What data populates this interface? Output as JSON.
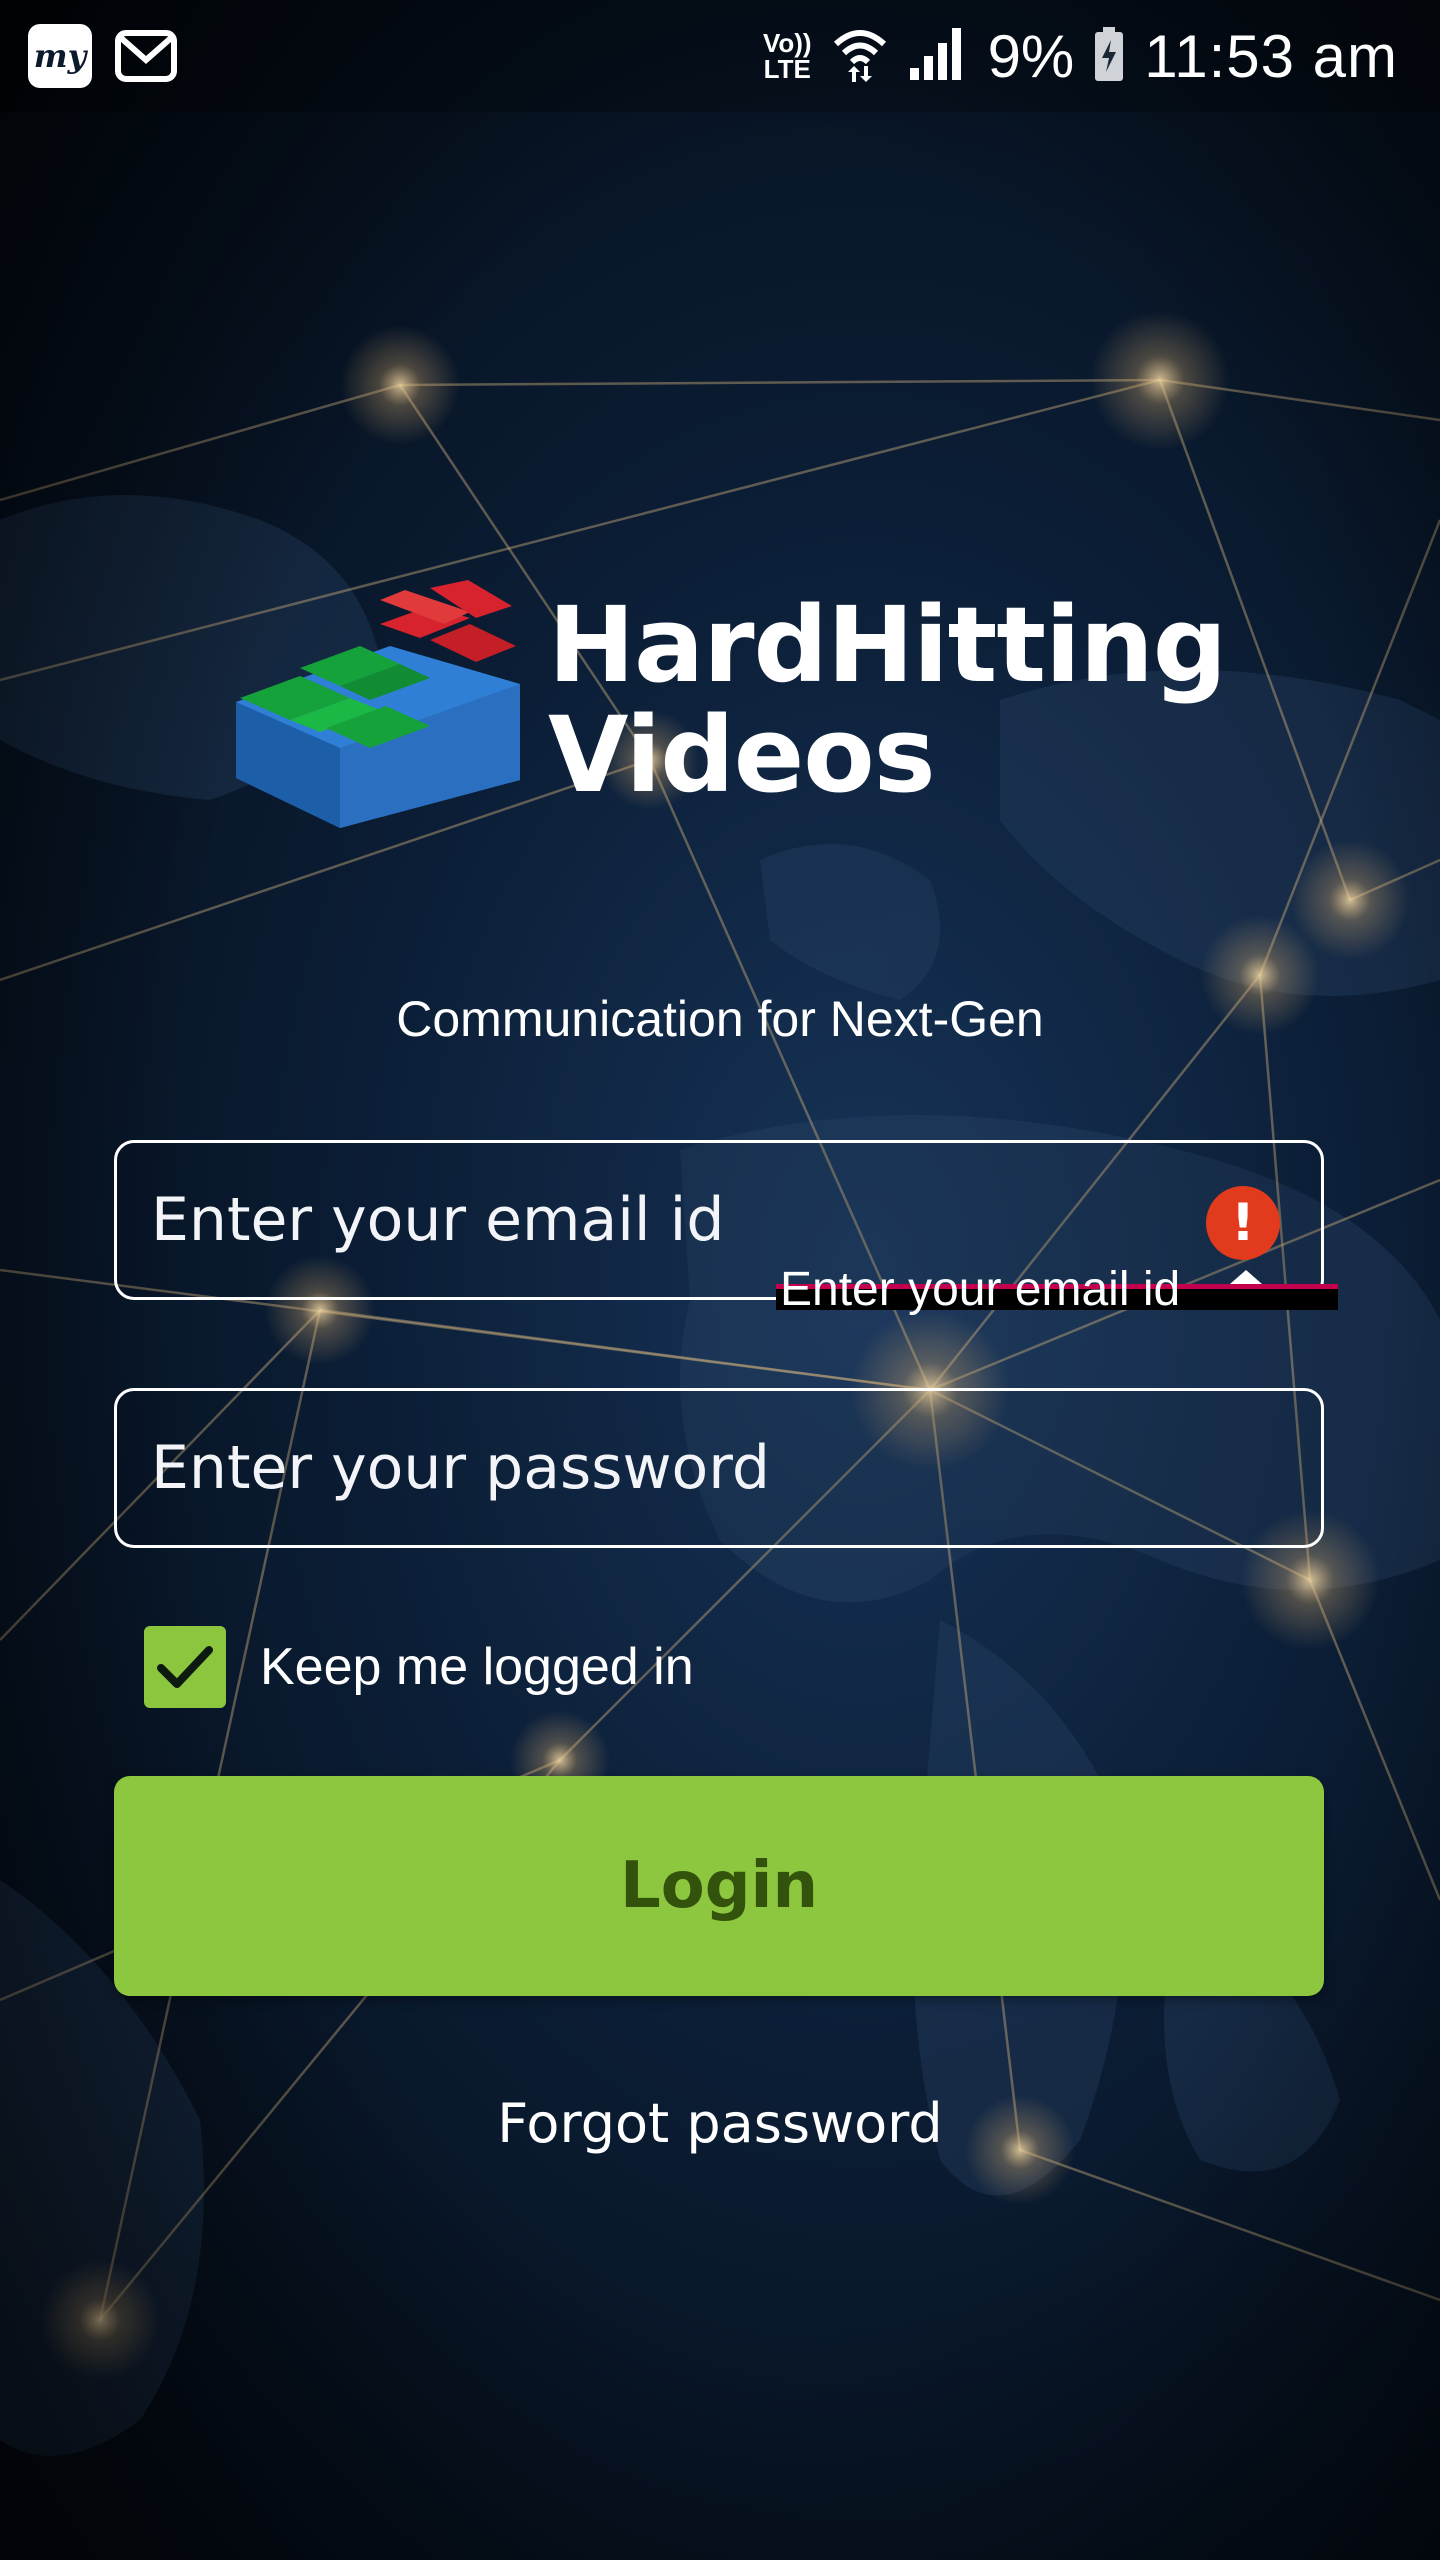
{
  "status_bar": {
    "app_icon_text": "my",
    "network_type_top": "Vo))",
    "network_type_bottom": "LTE",
    "battery_percent": "9%",
    "time": "11:53 am"
  },
  "logo": {
    "line1": "HardHitting",
    "line2": "Videos",
    "mark_colors": {
      "red": "#d6232e",
      "green": "#16a23a",
      "blue": "#2f7fd6"
    }
  },
  "tagline": "Communication for Next-Gen",
  "form": {
    "email_placeholder": "Enter your email id",
    "email_value": "",
    "email_error": "Enter your email id",
    "password_placeholder": "Enter your password",
    "password_value": "",
    "keep_logged_in_label": "Keep me logged in",
    "keep_logged_in_checked": true,
    "login_label": "Login",
    "forgot_label": "Forgot password"
  },
  "colors": {
    "accent_green": "#8dc63f",
    "button_text": "#33520c",
    "error_red": "#e23a1d"
  }
}
